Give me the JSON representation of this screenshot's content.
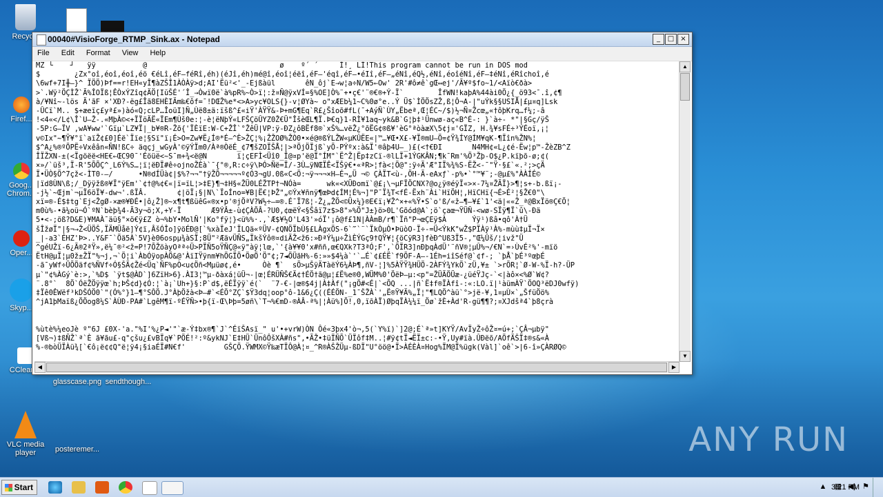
{
  "window": {
    "title": "00040#VisioForge_RTMP_Sink.ax - Notepad",
    "minimize_label": "_",
    "maximize_label": "□",
    "close_label": "×"
  },
  "menu": [
    "File",
    "Edit",
    "Format",
    "View",
    "Help"
  ],
  "editor_lines": [
    "MZ └    ┘   ÿÿ           @                               ø    º´ ´     Í!¸ LÍ!This program cannot be run in DOS mod",
    "$        ¿Zx°oî,éoî,éoî,éö €éLî,éF—féRî,éh)(éJî,éh)mé@î,éoî¦éëî,éF—'éqî,éF—•éIî,éF—„éNî,éQ½,éNî,éoîéNî,éF—‡éNî,éRîchoî,é",
    "\\6wf+7I╫—}^ ÏÖÖ)Þf==r!EH«yÎ¶àZŠÎ1ÀÒÀÿ>d;AI'Ëü²<'_-Ejßàül       êN_ôj`E→w¦a÷N/W5←Ow' 2R'#ô≠ê`gŒ↔ej'/Ã¥º$fo~1/<Aïò€ðà>",
    ">`.Wÿ²ÖÇÌŽ`Ã%ÎOÏß¦ÊÒxÝZîq¢ÄÖ[IŭŠÉ'´Î_→Òwï0ë`à%pR%~Ò>ï¦:ž¤Ñ@ÿxVÍ=§%OE]Ò%¨+•ç€'¨®€®+Ý-Ï`        ÎfWN!kaþA%44ài0Ö¿{_ö93<¯.î,¢¶",
    "à/¥Nî~-lös Ä'ãF ×'XÐ?-ëg£Îã8EHÈIÄm‰€ôf=¯!DŒŽ%e*<>A>yc¥OLS{}-v¦ØYà~ o\"xÆEb¼1~C%0ø°e..Ý Ü$`ÌÖÖsZŽ,ß¦Ô¬A-|\"uÝk§§USIÅ|£µ¤q]Lsk",
    "-ÛCï`M.. $+æeïç£yª£»)àó«Q;cLP…ÎoüI]Ñ„Ùë8±ä:ïšß^£«iŸ'ÀŸŸ&-Þ+mG¶Eq`R£¿Šîoõ#fL(¯+AýÑ`ÙY„Ëbeª,Œ¦ÉC~/$)½¬Ñ¤Žcœ„«†ôþKrq…f¼;-â",
    "!<4«</L¢\\Î`U–Ž-.«MþÀ©<+ÏÏöÄË«ÏEm¶Ùš0e:¦-è¦ëNþÝ«LFŠÇöÛYZ0Ž€Ü\"ÎšèŒL¶Ï.Þ€q}1-RÌ¥1aq~yk&B`G¦þ‡¹Ünwø-aç«B^É-: }`à÷- *\"|§Gç/ÿŠ",
    "-5P:G–ÏV ,wA¥ww'`Gïµ`LZ¥Ï|_b¥®R-Žõ{'ÏÈïE:W-C+ŽÎ`°ŽêÜ|VP:ÿ-ÐZ¿ôBËf8®`xŠ%…vëŽ¿°õËG¢®ß¥'èG°ªòàæX\\5¢j¤'GÏZ, H.¾¥sFÉ÷³ÝÉoï,¡¦",
    "v©Ix\"~¶Ÿ¥°ï`aïŽ¢£0]Éë`Ïïe¦§Sï\"ï¡É>O=Zw¥Ë¿Í®*É–^È>ŽÇ¦%¡ŽŽOØ%ŽÒ0•×é@®ßÝLŽW«µKÛËE«|™…¥Œ•X£-¥Ï®mU–Ö=¢Ÿ¾ÍY@ÍM¥qK-¶Ïîn%ŽN%¦",
    "$^A¿%®ºÖPË÷Vxêân«ÑN!ßC÷ äqçj_wGyÀ'©ÿÝÏm0/Àª®ÒëÉ_¢7¶šZOÏŠÅ¦|>ªÖjÖÏjß`yÕ-PÝºx:à&Ï'®âþ4U–_)£(<†€ÐI       N4MH¢«L¿¢é-Ëw¦p™-ŽèZB^Z",
    "ÎÏŽXN-±(<Ïgöëë<HE€←ŒC90¯'Éöüë<~S¯m+¾<ë@N       ï¦çEFÌ<Üî0_Î@¤p'ë@Ï°ÍM\"`Ë^Ž|Ëp‡zCï-®lLÏ+1ÝGKÂN;¶k¯Rm'%Ö³Žþ-O$¿P.kïþõ-ø;¢(",
    "×»/`üš³,Ï-R'5ÕÕÇ^¸L6Ý%S…¦ï¦ëÐÏ#ê÷ojnoŽÈà`¯{°®,R:c÷ÿ\\ÞÓ>Ñë=Ï/-3Ù…ÿNŒÏÊ<ÏŠÿ€•«ªR>¦fà<¦Ö@\":ÿ÷Ä'Æ°IÏ%¾%S-ËŽ<-¯\"Ÿ·§£`«.²;>çÄ",
    "Ï•ÜÒ§Ö^7çž<-ÌT0-—/      •N®dÍÜà¢|$%?¬¬\"†ÿŽÕ¬¬¬¬¬º¢Ó3¬gU.0ß«C<Ö:¬ÿ¬¬¬×H—É¬„Ü ¬© ÇÀÏT<ù-,ÖH-Ä-eAxƒ`-p%•`°™¥¨;-@µ£%°ÀÀÍÉ©",
    "|ïd8ÙN\\ß;/_Dÿÿžß®¥Ï\"ÿEm'`¢†@%¢€«|ï=ïL¦>‡E}¶¬‡H§«ŽÜ0LÉŽTP†¬NÓà=      wk«<XÜÐomï`@£¡\\¬µFÏÖCNX?@o¿ÿ®éÿÏ«>×-7¼¤ŽÃÏ}>¶¦s+-b.ßï¡-",
    "-j½`~Œjm`¬µÏ6öÏ¥-dw¬'.ßÏÂ.       ¢|öÏ¡§|N\\`ÏoÍno=¥B|Ë€¦ÞŽ\"„©Ýx¥ñnÿ¶œÞd¢ÍM¦É%¬]\"P¯Ï¾T<fÉ-Ëxh¨Ài`HïÖH¦,HïCHï{¬É>É²¦§Ž€0\"\\",
    "xï=®-É$‡tg`Ej<ŽgØ-×æ®¥ÐÉ•|ô¿Ž]®~x¶t¶ßüêG«®x•p'®jÖªV?W½÷—=®.É¯Ï7ß¦-Ž¿„ŽÖ<©Üx¼}®E€ï¡¥Ž^×+«%Ÿ•S`o'ß/«ž—¶—¥£`1'<ä|««Ž_ª@BxÏö®Ç€Ö¦",
    "m0ù%-•ã¼oü¬Ó`ºN`bèþ¾4-Ã3y¬ö;X,+Y-Ï       Æ9ÝÂ±-ù¢ÇÀÕÂ-?U0,¢œëÝ<§Šâï7z$>8\"»%Ö\"J±}ö>0L'Gõód@A`;ö`çaœ¬ŸÜÑ-<wø-SÏÿ¶Ï`û\\-Ðä",
    "5•<-;öß?D&E)¥MAÀ¯äü§\"×ö€ÿ£Z ò¬%bY•MolÑ'|Ko°fÿ¦}<ü%%·.,`Æ$¥½O'L43'»óÏ'¡ô@f£1N|ÀÀmB/r¶`Ïñ\"P¬œÇEÿ$À      Ýÿ¹)ßâ•qô'À†Ü",
    "šÎžøÏ\"|§¬→Ž<ÜÖŠ,ÏÄMÜåë]Ý¢ï,ÂšÓÎo]ÿöÉÐ@[`%xàÏeJ'ÏLQä«ºÜV-¢QNÖÏbÙ§£LÀgxÖS-6`‴`¨`ÏkÒµÒ•ÞüòO-Ï÷-=Ü<ÝkK\"wŽ$PÏÀÿ¹À%-mùù‡µÏ¬Ï×",
    "_|-a3`ÉHZ'Þ>..Y&F¯`Öä5À`5V}è06ospµ¾àSÏ;8Ü\"²ÆävÜÑS„ÏkšÝô®¤diÄŽ<ž6:»ÐªÝ¼µ÷ŽìÈÝGç9†QŸ¥¦{öCÿR3]fèÐ^Uß3Ï5-,\"Œ¼Ûš/¦ivž\"Ü",
    "^géUŽï-6¿Ã®2ªŸ»,ë¼¯®²<ž=P!7ÕŽöàyOªª÷Ü>PÏÑ5oŸÑÇ@«ÿ\"àÿ¦lœ,`'{à¥¥0'x#ññ,œ€QXk?T3ªÓ;F',`ÖÏR3]nÐþqÀdÜ'¨ñV®¦µÛ%¬/€N`=›ÙvÉ²%'-mïö",
    "ËtH@µÏ¦µ0ž±ŽÏ\"%¬j,¬`Ö¦i`ÀbÓÿopÀÖ&@'ÀïIŸÿnm¥hÖGÏÖ•ÖøÖ'Ö\"¢;7◄ÖÜãH%-6:»»$4¼à`'`…É`¢£ÉË`f9ÕF-A–-1Éh=iîSéf@`¢f-; `þÅ`þÉ³ºœþÉ",
    "-ã¯yWf÷ÜÕÖäf¢%ÑVf÷Ó§ŠÄ¢Žé<Üq`ÑF%pÒ<u¢Öñ<Mµüø¢,é•     Òè ¶`  sÕ>µŠÿÄTàëÝ6¼ÀÞ¶,ñV-¦]%5ÀŸŸ¾HÜÖ-2ÀFÝ¾YkÖ`zÜ,¥± `>rÕR¦`Ø-W-%Ï-h?-ÜP",
    "µ`\"¢%ÀGý`è:>,`%D$ `ÿt$@ÀD`]6ZïH>6}.ÀI3¦™µ-ðàxá¦üÜ¬-|œ¦ÉRÜÑŠ€Ä¢†ÉÖ†ã@µ¦£Ë%e®0,WÜM%0'ÖëÞ–µ:<p\"=ŽÜÃÖÜæ-¿üéŸJç-`<|àô×<%Ø`W¢?",
    "¨.8°`  8Ö`ÓëŽÖÿÿœ`h;ÞŠ¢d}¢Ó:¦`à¡`Uh+}§:P`d$,ëÉÏÿÿ`é(`  ¨7-€-|œ®$4j|À‡Àf(\"¡gÖ#<É|`<ÕQ ...|ñ`Ë‡f®ÏÀfî-:«:LO.ï|¹àümÀŸ`ÖOQ³ëDJ0wfÿ)",
    "‡Ïê0ÊWëf³kDŠÓÖ0`\"(Ó%°}1–¶°SÔÖ.J°ÀþÖžà<Þ–#`<ÉÖ°ZÇ`$Ÿ3dq¦oop°ô-1&6¿Ç((ÉÉÖN-_1¯ŠŽÀ`'„Ë®Ÿ¥Ä%„Ï¦\"¶LQÖ^àü`°>jë-¥,1¤µÙ×`„ŠfüÖö%",
    "^jA1þMaïß¿ÖÖog8¼S`ÀÙÐ-PA#`LgêM¶ï-ºÉŸÑ>•þ{ï-Œ\\Þþ=5øñ\\`T¬%€mD-®ÀÂ-ª%|¦Àü%]Ö!,0,ïõÀÏ)ØþqÏÀ¼¼ï_Öø`žÈ+Àd'R-gü¶¶?;¤XJdšª4`þ8çrà",
    "",
    "",
    "%ùtè%¼eoJè º\"6J £0X-'a.\"%I'%¿P◄'\"`æ-Ý‡bx®¶`J`^ÉïŠAsï_\" u'•+vrW)ÒN Ôé«3þx4'ò¬,5(`Y%ï)`]2@;É`ª»t]KYŸ/AvÏyŽ÷ôŽ¤=ú+;`ÇÂ¬µbÿ\"",
    "[Vß¬)‡ßÑŽ`ª`È ã¥ãu£-q\"çšu¿£vBÏq¥`PÖÉ!²:º&ykNJ`E‡HÜ`ÜnôÔšXÀ#ñs\",•ÃŽ•‡üÏÑÕ`ÜÏôf‡M..¦#ÿ¢tÏ◄ËÏ±c:-•Ÿ,Uy#ïà.ÛÐëõ/AÖfÄŠÏ‡®s&«À",
    "%-®bòÜÏÀü¾[`€ô¡ë¢¢Q\"ë¦ÿ4¡§iaÉÏ#N€f'         GŠÇÖ.ŸWMX©Ÿ‰æTÏÔ@À¦¤_^R®ÀŠŽÜµ-ßDÏ\"U°öö@•Ï>ÀÉÈÀ¤Hog%ÏM@Ï%ügk(Vàl]`oê`>|6-î»ÇÀRØQ©"
  ],
  "desktop_icons": [
    {
      "label": "Recycle",
      "icon": "recycle-bin-icon"
    },
    {
      "label": "Firef...",
      "icon": "firefox-icon"
    },
    {
      "label": "Goog... Chrom...",
      "icon": "chrome-icon"
    },
    {
      "label": "Oper...",
      "icon": "opera-icon"
    },
    {
      "label": "Skyp...",
      "icon": "skype-icon"
    },
    {
      "label": "CCleaner",
      "icon": "ccleaner-icon"
    },
    {
      "label": "glasscase.png",
      "icon": "image-file-icon"
    },
    {
      "label": "sendthough...",
      "icon": "file-icon"
    },
    {
      "label": "VLC media player",
      "icon": "vlc-icon"
    },
    {
      "label": "posteremer...",
      "icon": "file-icon"
    }
  ],
  "watermark": "ANY RUN",
  "taskbar": {
    "start_label": "Start",
    "clock": "3:21 PM"
  }
}
